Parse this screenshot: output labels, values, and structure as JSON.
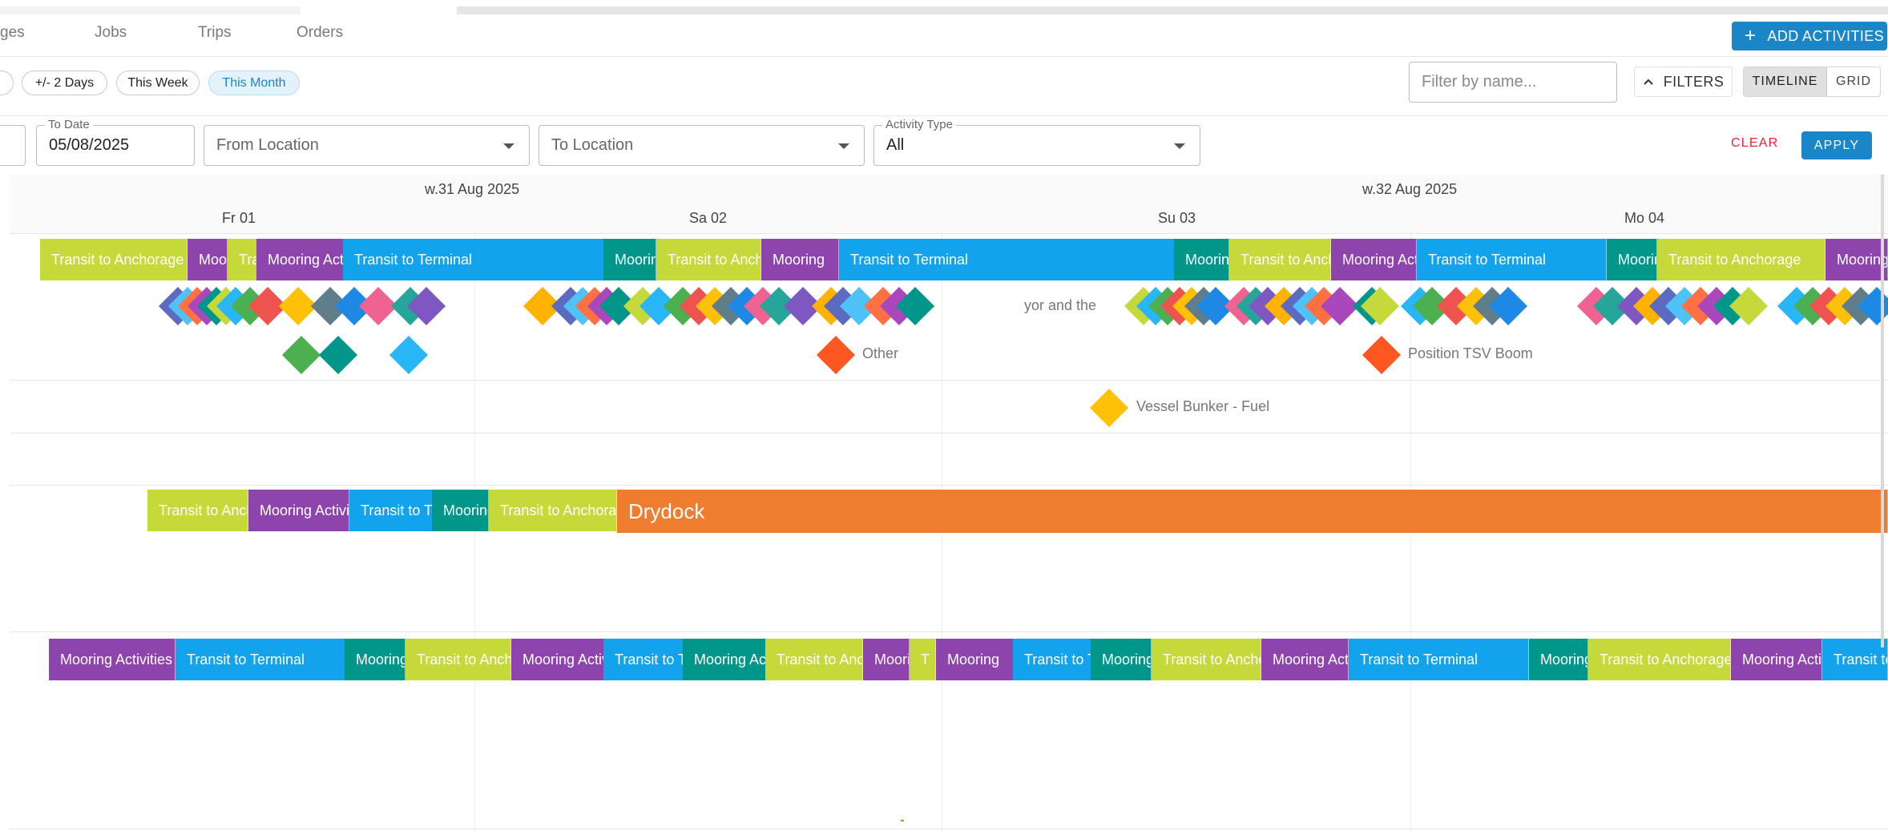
{
  "nav": {
    "tabs": [
      "ges",
      "Jobs",
      "Trips",
      "Orders"
    ],
    "add_button": "ADD ACTIVITIES"
  },
  "quick_ranges": [
    {
      "label": "+/- 2 Days",
      "active": false
    },
    {
      "label": "This Week",
      "active": false
    },
    {
      "label": "This Month",
      "active": true
    }
  ],
  "toolbar": {
    "filter_placeholder": "Filter by name...",
    "filters_label": "FILTERS",
    "view_timeline": "TIMELINE",
    "view_grid": "GRID",
    "active_view": "TIMELINE"
  },
  "filters": {
    "to_date_label": "To Date",
    "to_date_value": "05/08/2025",
    "from_location_placeholder": "From Location",
    "to_location_placeholder": "To Location",
    "activity_type_label": "Activity Type",
    "activity_type_value": "All",
    "clear_label": "CLEAR",
    "apply_label": "APPLY"
  },
  "timeline": {
    "weeks": [
      "w.31 Aug 2025",
      "w.32 Aug 2025"
    ],
    "days": [
      "Fr 01",
      "Sa 02",
      "Su 03",
      "Mo 04"
    ],
    "colors": {
      "transit_anchorage": "#c5d93a",
      "mooring": "#8e44ad",
      "transit_terminal": "#12a3ec",
      "mooring_teal": "#00968a",
      "drydock": "#ee7d2f"
    },
    "row1": [
      {
        "label": "Transit to Anchorage",
        "type": "transit_anchorage"
      },
      {
        "label": "Mooring Activities",
        "type": "mooring"
      },
      {
        "label": "Transit to Anchorage",
        "type": "transit_anchorage"
      },
      {
        "label": "Mooring Activities",
        "type": "mooring"
      },
      {
        "label": "Transit to Terminal",
        "type": "transit_terminal"
      },
      {
        "label": "Mooring",
        "type": "mooring_teal"
      },
      {
        "label": "Transit to Anchorage",
        "type": "transit_anchorage"
      },
      {
        "label": "Mooring",
        "type": "mooring"
      },
      {
        "label": "Transit to Terminal",
        "type": "transit_terminal"
      },
      {
        "label": "Mooring",
        "type": "mooring_teal"
      },
      {
        "label": "Transit to Anchorage",
        "type": "transit_anchorage"
      },
      {
        "label": "Mooring Activities",
        "type": "mooring"
      },
      {
        "label": "Transit to Terminal",
        "type": "transit_terminal"
      },
      {
        "label": "Mooring",
        "type": "mooring_teal"
      },
      {
        "label": "Transit to Anchorage",
        "type": "transit_anchorage"
      },
      {
        "label": "Mooring",
        "type": "mooring"
      }
    ],
    "row2": [
      {
        "label": "Transit to Anchorage",
        "type": "transit_anchorage"
      },
      {
        "label": "Mooring Activities",
        "type": "mooring"
      },
      {
        "label": "Transit to Terminal",
        "type": "transit_terminal"
      },
      {
        "label": "Mooring",
        "type": "mooring_teal"
      },
      {
        "label": "Transit to Anchorage",
        "type": "transit_anchorage"
      },
      {
        "label": "Drydock",
        "type": "drydock"
      }
    ],
    "row3": [
      {
        "label": "Mooring Activities",
        "type": "mooring"
      },
      {
        "label": "Transit to Terminal",
        "type": "transit_terminal"
      },
      {
        "label": "Mooring",
        "type": "mooring_teal"
      },
      {
        "label": "Transit to Anchorage",
        "type": "transit_anchorage"
      },
      {
        "label": "Mooring Activities",
        "type": "mooring"
      },
      {
        "label": "Transit to Terminal",
        "type": "transit_terminal"
      },
      {
        "label": "Mooring Activities",
        "type": "mooring_teal"
      },
      {
        "label": "Transit to Anchorage",
        "type": "transit_anchorage"
      },
      {
        "label": "Mooring",
        "type": "mooring"
      },
      {
        "label": "T",
        "type": "transit_anchorage"
      },
      {
        "label": "Mooring",
        "type": "mooring"
      },
      {
        "label": "Transit to Terminal",
        "type": "transit_terminal"
      },
      {
        "label": "Mooring",
        "type": "mooring_teal"
      },
      {
        "label": "Transit to Anchorage",
        "type": "transit_anchorage"
      },
      {
        "label": "Mooring Activities",
        "type": "mooring"
      },
      {
        "label": "Transit to Terminal",
        "type": "transit_terminal"
      },
      {
        "label": "Mooring",
        "type": "mooring_teal"
      },
      {
        "label": "Transit to Anchorage",
        "type": "transit_anchorage"
      },
      {
        "label": "Mooring Activities",
        "type": "mooring"
      },
      {
        "label": "Transit to Terminal",
        "type": "transit_terminal"
      }
    ],
    "event_labels": {
      "other": "Other",
      "position_tsv_boom": "Position TSV Boom",
      "vessel_bunker_fuel": "Vessel Bunker - Fuel",
      "surveyor": "yor and the"
    }
  }
}
